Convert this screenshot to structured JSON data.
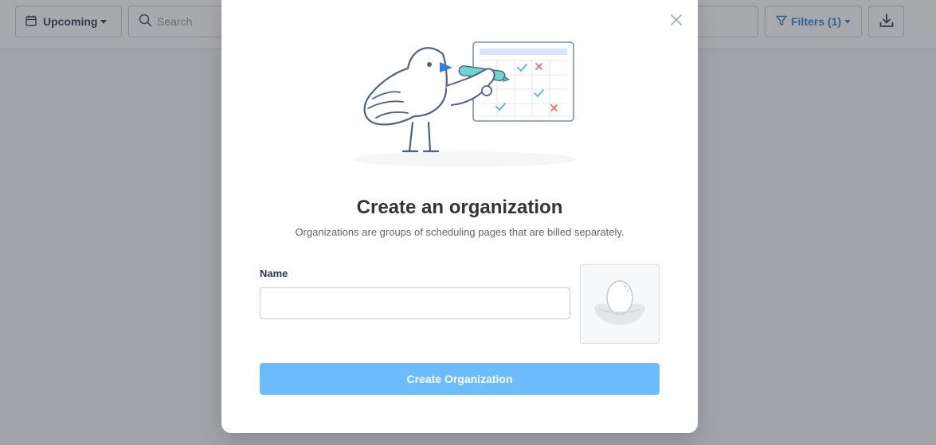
{
  "toolbar": {
    "upcoming_label": "Upcoming",
    "search_placeholder": "Search",
    "filters_label": "Filters (1)",
    "accent_color": "#2f7fe0",
    "icons": {
      "upcoming": "calendar-icon",
      "search": "search-icon",
      "filters": "filter-icon",
      "download": "download-icon"
    }
  },
  "modal": {
    "title": "Create an organization",
    "subtitle": "Organizations are groups of scheduling pages that are billed separately.",
    "name_label": "Name",
    "name_value": "",
    "submit_label": "Create Organization",
    "submit_color": "#6cbcfb",
    "icons": {
      "close": "close-icon",
      "illustration": "bird-calendar-illustration",
      "avatar": "egg-nest-placeholder-icon"
    }
  }
}
